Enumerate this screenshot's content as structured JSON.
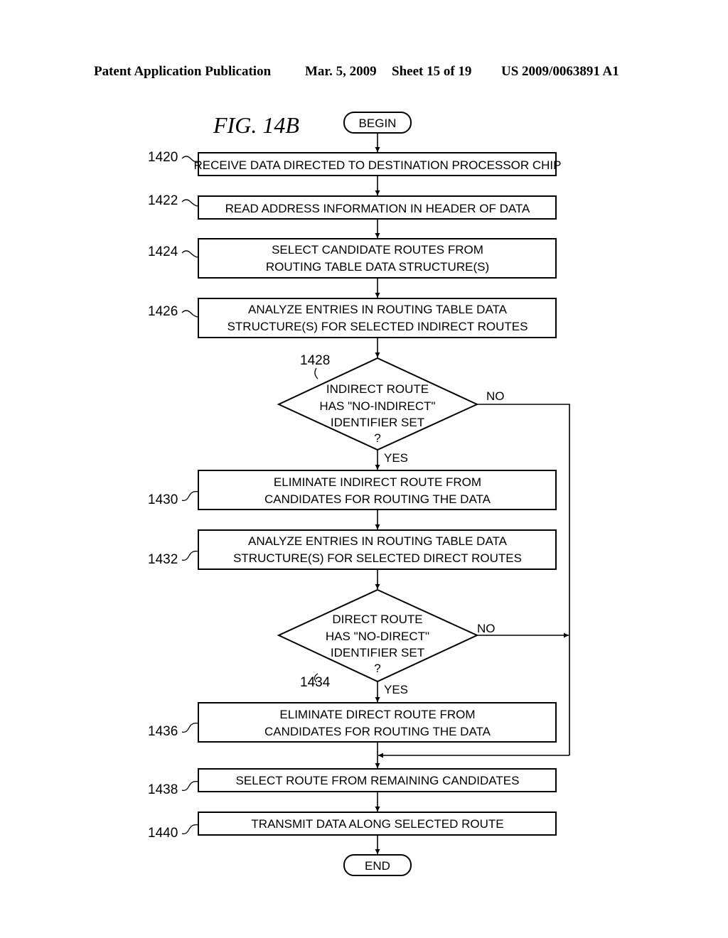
{
  "header": {
    "left": "Patent Application Publication",
    "date": "Mar. 5, 2009",
    "sheet": "Sheet 15 of 19",
    "number": "US 2009/0063891 A1"
  },
  "figure": {
    "label": "FIG. 14B",
    "begin": "BEGIN",
    "end": "END",
    "steps": [
      {
        "ref": "1420",
        "lines": [
          "RECEIVE DATA DIRECTED TO DESTINATION PROCESSOR CHIP"
        ]
      },
      {
        "ref": "1422",
        "lines": [
          "READ ADDRESS INFORMATION IN HEADER OF DATA"
        ]
      },
      {
        "ref": "1424",
        "lines": [
          "SELECT CANDIDATE ROUTES FROM",
          "ROUTING TABLE DATA STRUCTURE(S)"
        ]
      },
      {
        "ref": "1426",
        "lines": [
          "ANALYZE ENTRIES IN ROUTING TABLE DATA",
          "STRUCTURE(S) FOR SELECTED INDIRECT ROUTES"
        ]
      },
      {
        "ref": "1430",
        "lines": [
          "ELIMINATE INDIRECT ROUTE FROM",
          "CANDIDATES FOR ROUTING THE DATA"
        ]
      },
      {
        "ref": "1432",
        "lines": [
          "ANALYZE ENTRIES IN ROUTING TABLE DATA",
          "STRUCTURE(S) FOR SELECTED DIRECT ROUTES"
        ]
      },
      {
        "ref": "1436",
        "lines": [
          "ELIMINATE DIRECT ROUTE FROM",
          "CANDIDATES FOR ROUTING THE DATA"
        ]
      },
      {
        "ref": "1438",
        "lines": [
          "SELECT ROUTE FROM REMAINING CANDIDATES"
        ]
      },
      {
        "ref": "1440",
        "lines": [
          "TRANSMIT DATA ALONG SELECTED ROUTE"
        ]
      }
    ],
    "decisions": [
      {
        "ref": "1428",
        "lines": [
          "INDIRECT ROUTE",
          "HAS \"NO-INDIRECT\"",
          "IDENTIFIER SET",
          "?"
        ],
        "yes": "YES",
        "no": "NO"
      },
      {
        "ref": "1434",
        "lines": [
          "DIRECT ROUTE",
          "HAS \"NO-DIRECT\"",
          "IDENTIFIER SET",
          "?"
        ],
        "yes": "YES",
        "no": "NO"
      }
    ]
  }
}
